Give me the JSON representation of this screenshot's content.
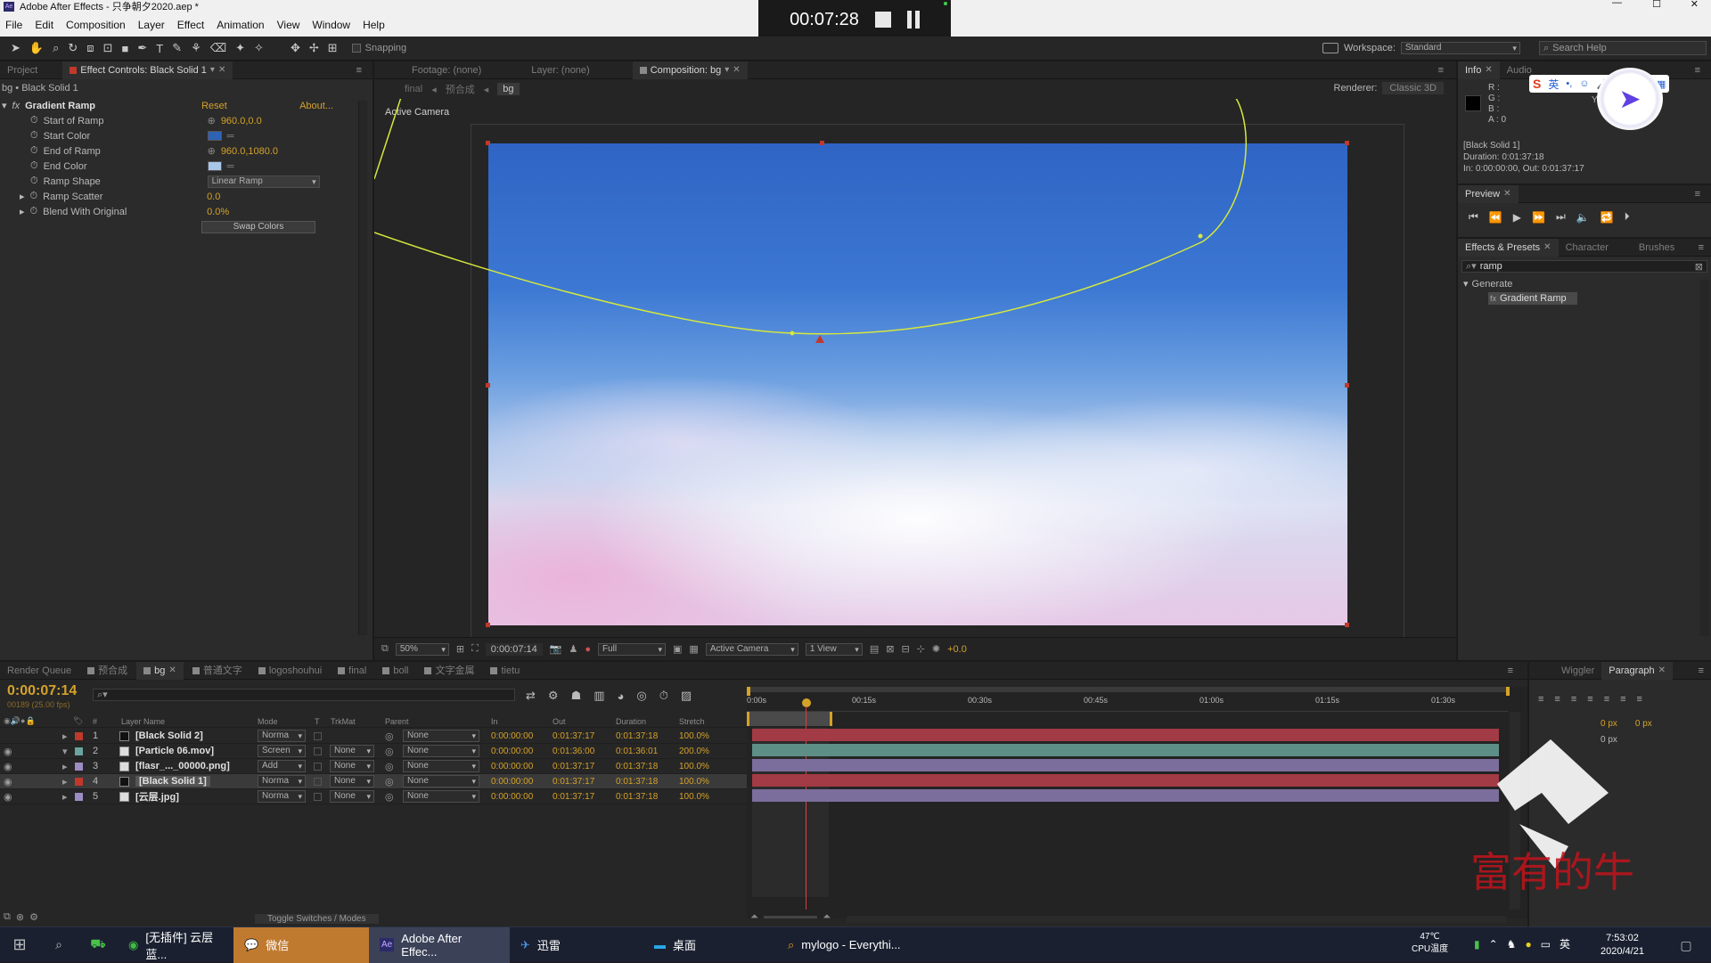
{
  "app": {
    "title": "Adobe After Effects - 只争朝夕2020.aep *",
    "menu": [
      "File",
      "Edit",
      "Composition",
      "Layer",
      "Effect",
      "Animation",
      "View",
      "Window",
      "Help"
    ],
    "recorder_time": "00:07:28"
  },
  "toolbar": {
    "snapping_label": "Snapping",
    "workspace_label": "Workspace:",
    "workspace_value": "Standard",
    "search_placeholder": "Search Help"
  },
  "effect_controls": {
    "tabs": [
      "Project",
      "Effect Controls: Black Solid 1"
    ],
    "breadcrumb": "bg • Black Solid 1",
    "effect_name": "Gradient Ramp",
    "reset_label": "Reset",
    "about_label": "About...",
    "props": {
      "start_of_ramp": {
        "label": "Start of Ramp",
        "value": "960.0,0.0"
      },
      "start_color": {
        "label": "Start Color",
        "color": "#2e63b6"
      },
      "end_of_ramp": {
        "label": "End of Ramp",
        "value": "960.0,1080.0"
      },
      "end_color": {
        "label": "End Color",
        "color": "#a8c6e6"
      },
      "ramp_shape": {
        "label": "Ramp Shape",
        "value": "Linear Ramp"
      },
      "ramp_scatter": {
        "label": "Ramp Scatter",
        "value": "0.0"
      },
      "blend": {
        "label": "Blend With Original",
        "value": "0.0%"
      }
    },
    "swap_label": "Swap Colors"
  },
  "viewer": {
    "tabs": [
      "Footage: (none)",
      "Layer: (none)",
      "Composition: bg"
    ],
    "crumbs": [
      "final",
      "预合成",
      "bg"
    ],
    "renderer_label": "Renderer:",
    "renderer_value": "Classic 3D",
    "camera_label": "Active Camera",
    "footer": {
      "zoom": "50%",
      "time": "0:00:07:14",
      "resolution": "Full",
      "camera": "Active Camera",
      "views": "1 View",
      "exposure": "+0.0"
    }
  },
  "info_panel": {
    "tabs": [
      "Info",
      "Audio"
    ],
    "channels": [
      "R :",
      "G :",
      "B :",
      "A : 0"
    ],
    "coord": "Y : 80",
    "lines": [
      "[Black Solid 1]",
      "Duration: 0:01:37:18",
      "In: 0:00:00:00, Out: 0:01:37:17"
    ]
  },
  "preview_panel": {
    "title": "Preview"
  },
  "effects_presets": {
    "tabs": [
      "Effects & Presets",
      "Character",
      "Brushes"
    ],
    "search_value": "ramp",
    "category": "Generate",
    "item": "Gradient Ramp"
  },
  "timeline": {
    "tabs": [
      "Render Queue",
      "预合成",
      "bg",
      "普通文字",
      "logoshouhui",
      "final",
      "boll",
      "文字金属",
      "tietu"
    ],
    "current_time": "0:00:07:14",
    "frame_info": "00189 (25.00 fps)",
    "columns": [
      "#",
      "Layer Name",
      "Mode",
      "T",
      "TrkMat",
      "Parent",
      "In",
      "Out",
      "Duration",
      "Stretch"
    ],
    "ruler": [
      "0:00s",
      "00:15s",
      "00:30s",
      "00:45s",
      "01:00s",
      "01:15s",
      "01:30s"
    ],
    "toggle_label": "Toggle Switches / Modes",
    "layers": [
      {
        "num": "1",
        "name": "[Black Solid 2]",
        "mode": "Norma",
        "trkmat": "",
        "parent": "None",
        "in": "0:00:00:00",
        "out": "0:01:37:17",
        "dur": "0:01:37:18",
        "stretch": "100.0%",
        "color": "#c0392b",
        "bar": "#a23b45"
      },
      {
        "num": "2",
        "name": "[Particle 06.mov]",
        "mode": "Screen",
        "trkmat": "None",
        "parent": "None",
        "in": "0:00:00:00",
        "out": "0:01:36:00",
        "dur": "0:01:36:01",
        "stretch": "200.0%",
        "color": "#6aa5a0",
        "bar": "#5e8f86"
      },
      {
        "num": "3",
        "name": "[flasr_..._00000.png]",
        "mode": "Add",
        "trkmat": "None",
        "parent": "None",
        "in": "0:00:00:00",
        "out": "0:01:37:17",
        "dur": "0:01:37:18",
        "stretch": "100.0%",
        "color": "#9e8cc4",
        "bar": "#7c6e9c"
      },
      {
        "num": "4",
        "name": "[Black Solid 1]",
        "mode": "Norma",
        "trkmat": "None",
        "parent": "None",
        "in": "0:00:00:00",
        "out": "0:01:37:17",
        "dur": "0:01:37:18",
        "stretch": "100.0%",
        "color": "#c0392b",
        "bar": "#a23b45"
      },
      {
        "num": "5",
        "name": "[云层.jpg]",
        "mode": "Norma",
        "trkmat": "None",
        "parent": "None",
        "in": "0:00:00:00",
        "out": "0:01:37:17",
        "dur": "0:01:37:18",
        "stretch": "100.0%",
        "color": "#9e8cc4",
        "bar": "#7c6e9c"
      }
    ]
  },
  "paragraph_panel": {
    "tabs": [
      "Wiggler",
      "Paragraph"
    ],
    "px1": "0 px",
    "px2": "0 px",
    "px3": "0 px"
  },
  "taskbar": {
    "items": [
      "[无插件] 云层蓝...",
      "微信",
      "Adobe After Effec...",
      "迅雷",
      "桌面",
      "mylogo - Everythi..."
    ],
    "temp": "47℃",
    "cpu": "CPU温度",
    "ime": "英",
    "time": "7:53:02",
    "date": "2020/4/21"
  },
  "colors": {
    "accent": "#d5a229",
    "playhead": "#e03a3a",
    "path": "#d6e83c"
  }
}
